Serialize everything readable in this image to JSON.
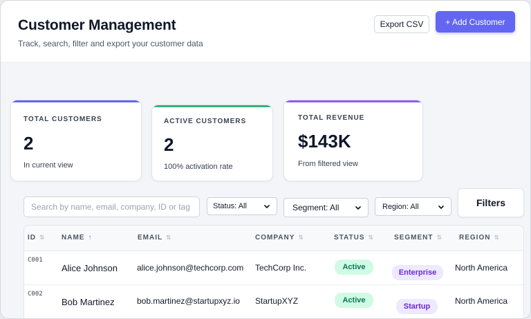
{
  "header": {
    "title": "Customer Management",
    "subtitle": "Track, search, filter and export your customer data",
    "export_label": "Export CSV",
    "add_label": "+ Add Customer"
  },
  "stats": [
    {
      "label": "TOTAL CUSTOMERS",
      "value": "2",
      "sub": "In current view",
      "accent": "#6366f1"
    },
    {
      "label": "ACTIVE CUSTOMERS",
      "value": "2",
      "sub": "100% activation rate",
      "accent": "#34b27b"
    },
    {
      "label": "TOTAL REVENUE",
      "value": "$143K",
      "sub": "From filtered view",
      "accent": "#8b5cf6"
    }
  ],
  "filters": {
    "search_placeholder": "Search by name, email, company, ID or tag",
    "status": "Status: All",
    "segment": "Segment: All",
    "region": "Region: All",
    "filters_label": "Filters"
  },
  "table": {
    "columns": [
      "ID",
      "NAME",
      "EMAIL",
      "COMPANY",
      "STATUS",
      "SEGMENT",
      "REGION"
    ],
    "sort_column": "NAME",
    "rows": [
      {
        "id": "C001",
        "name": "Alice Johnson",
        "email": "alice.johnson@techcorp.com",
        "company": "TechCorp Inc.",
        "status": "Active",
        "segment": "Enterprise",
        "region": "North America"
      },
      {
        "id": "C002",
        "name": "Bob Martinez",
        "email": "bob.martinez@startupxyz.io",
        "company": "StartupXYZ",
        "status": "Active",
        "segment": "Startup",
        "region": "North America"
      }
    ]
  },
  "colors": {
    "primary": "#6366f1",
    "active_badge_bg": "#d1fae5",
    "active_badge_text": "#047857",
    "segment_badge_bg": "#ede9fe",
    "segment_badge_text": "#6d28d9"
  },
  "icons": {
    "sort": "up-down-arrows-icon",
    "sort_active": "arrow-up-icon",
    "dropdown": "chevron-down-icon"
  }
}
